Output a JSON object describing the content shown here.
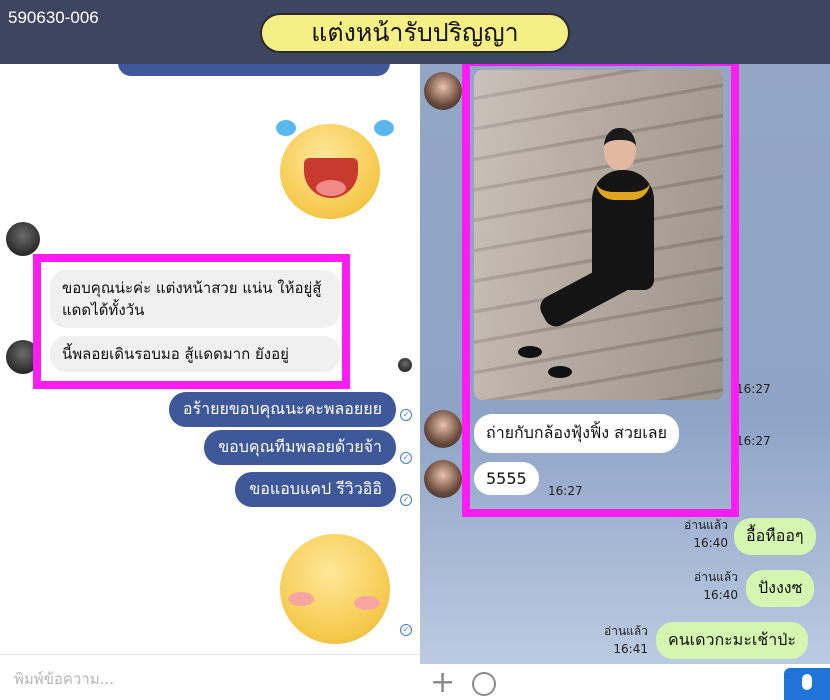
{
  "header": {
    "code": "590630-006",
    "title": "แต่งหน้ารับปริญญา"
  },
  "left_chat": {
    "received": [
      "ขอบคุณน่ะค่ะ แต่งหน้าสวย แน่น ให้อยู่สู้แดดได้ทั้งวัน",
      "นี้พลอยเดินรอบมอ สู้แดดมาก ยังอยู่"
    ],
    "sent": [
      "อร้ายยขอบคุณนะคะพลอยยย",
      "ขอบคุณทีมพลอยด้วยจ้า",
      "ขอแอบแคป รีวิวอิอิ"
    ],
    "composer_placeholder": "พิมพ์ข้อความ..."
  },
  "right_chat": {
    "photo_time": "16:27",
    "received": [
      {
        "text": "ถ่ายกับกล้องฟุ้งฟิ้ง สวยเลย",
        "time": "16:27"
      },
      {
        "text": "5555",
        "time": "16:27"
      }
    ],
    "sent": [
      {
        "read": "อ่านแล้ว",
        "time": "16:40",
        "text": "อื้อหืออๆ"
      },
      {
        "read": "อ่านแล้ว",
        "time": "16:40",
        "text": "ปังงงซ"
      },
      {
        "read": "อ่านแล้ว",
        "time": "16:41",
        "text": "คนเดวกะมะเช้าป่ะ"
      }
    ]
  },
  "colors": {
    "header_bg": "#3d4561",
    "title_pill": "#f6ef86",
    "highlight": "#ff1cf3",
    "messenger_sent": "#3e5899",
    "line_sent": "#d5f6b0",
    "line_bg": "#93a6c6"
  },
  "icons": [
    "plus-icon",
    "emoji-icon",
    "mic-icon",
    "read-tick-icon"
  ]
}
